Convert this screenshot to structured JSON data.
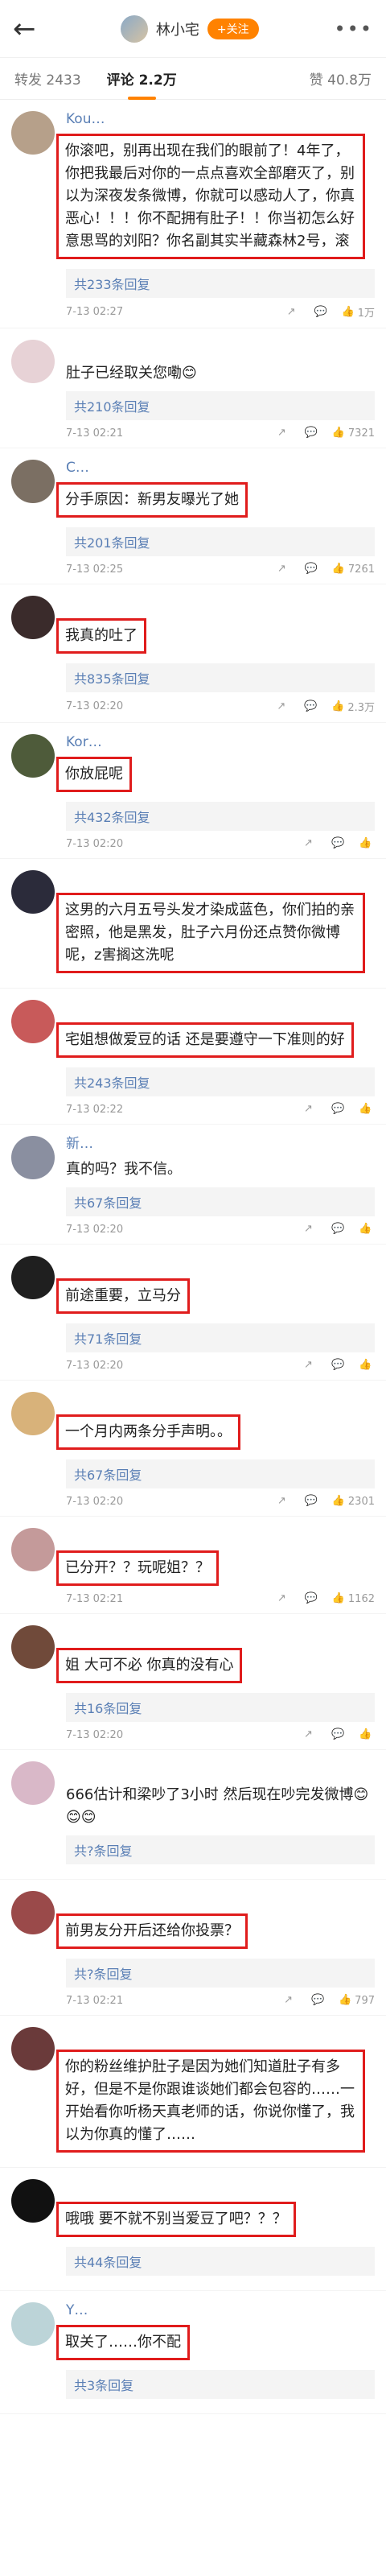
{
  "header": {
    "title": "林小宅",
    "follow_label": "+关注"
  },
  "tabs": {
    "repost": "转发 2433",
    "comments": "评论 2.2万",
    "likes": "赞 40.8万"
  },
  "comments": [
    {
      "name": "Kou…",
      "text": "你滚吧，别再出现在我们的眼前了！4年了，你把我最后对你的一点点喜欢全部磨灭了，别以为深夜发条微博，你就可以感动人了，你真恶心！！！你不配拥有肚子！！你当初怎么好意思骂的刘阳？你名副其实半藏森林2号，滚",
      "boxed": true,
      "replies": "共233条回复",
      "time": "7-13 02:27",
      "likes": "1万",
      "avatar_color": "#b6a08a"
    },
    {
      "name": "",
      "text": "肚子已经取关您嘞😊",
      "boxed": false,
      "replies": "共210条回复",
      "time": "7-13 02:21",
      "likes": "7321",
      "avatar_color": "#e7d2d6"
    },
    {
      "name": "C…",
      "text": "分手原因：新男友曝光了她",
      "boxed": true,
      "replies": "共201条回复",
      "time": "7-13 02:25",
      "likes": "7261",
      "avatar_color": "#7b6f63"
    },
    {
      "name": "",
      "text": "我真的吐了",
      "boxed": true,
      "replies": "共835条回复",
      "time": "7-13 02:20",
      "likes": "2.3万",
      "avatar_color": "#3a2b2b"
    },
    {
      "name": "Kor…",
      "text": "你放屁呢",
      "boxed": true,
      "replies": "共432条回复",
      "time": "7-13 02:20",
      "likes": "",
      "avatar_color": "#4e5b3a"
    },
    {
      "name": "",
      "text": "这男的六月五号头发才染成蓝色，你们拍的亲密照，他是黑发，肚子六月份还点赞你微博呢，z害搁这洗呢",
      "boxed": true,
      "replies": "",
      "time": "",
      "likes": "",
      "avatar_color": "#2b2b3a"
    },
    {
      "name": "",
      "text": "宅姐想做爱豆的话 还是要遵守一下准则的好",
      "boxed": true,
      "replies": "共243条回复",
      "time": "7-13 02:22",
      "likes": "",
      "avatar_color": "#c85a5a"
    },
    {
      "name": "新…",
      "text": "真的吗？我不信。",
      "boxed": false,
      "replies": "共67条回复",
      "time": "7-13 02:20",
      "likes": "",
      "avatar_color": "#8a8fa0"
    },
    {
      "name": "",
      "text": "前途重要，立马分",
      "boxed": true,
      "replies": "共71条回复",
      "time": "7-13 02:20",
      "likes": "",
      "avatar_color": "#1f1f1f"
    },
    {
      "name": "",
      "text": "一个月内两条分手声明。。",
      "boxed": true,
      "replies": "共67条回复",
      "time": "7-13 02:20",
      "likes": "2301",
      "avatar_color": "#d8b27a"
    },
    {
      "name": "",
      "text": "已分开？？玩呢姐？？",
      "boxed": true,
      "replies": "",
      "time": "7-13 02:21",
      "likes": "1162",
      "avatar_color": "#c49a9a"
    },
    {
      "name": "",
      "text": "姐 大可不必 你真的没有心",
      "boxed": true,
      "replies": "共16条回复",
      "time": "7-13 02:20",
      "likes": "",
      "avatar_color": "#704a3a"
    },
    {
      "name": "",
      "text": "666估计和梁吵了3小时 然后现在吵完发微博😊😊😊",
      "boxed": false,
      "replies": "共?条回复",
      "time": "",
      "likes": "",
      "avatar_color": "#d9b8c8"
    },
    {
      "name": "",
      "text": "前男友分开后还给你投票？",
      "boxed": true,
      "replies": "共?条回复",
      "time": "7-13 02:21",
      "likes": "797",
      "avatar_color": "#9a4a4a"
    },
    {
      "name": "",
      "text": "你的粉丝维护肚子是因为她们知道肚子有多好，但是不是你跟谁谈她们都会包容的……一开始看你听杨天真老师的话，你说你懂了，我以为你真的懂了……",
      "boxed": true,
      "replies": "",
      "time": "",
      "likes": "",
      "avatar_color": "#6a3a3a"
    },
    {
      "name": "",
      "text": "哦哦 要不就不别当爱豆了吧？？？",
      "boxed": true,
      "replies": "共44条回复",
      "time": "",
      "likes": "",
      "avatar_color": "#111111"
    },
    {
      "name": "Y…",
      "text": "取关了……你不配",
      "boxed": true,
      "replies": "共3条回复",
      "time": "",
      "likes": "",
      "avatar_color": "#bcd4d8"
    }
  ]
}
